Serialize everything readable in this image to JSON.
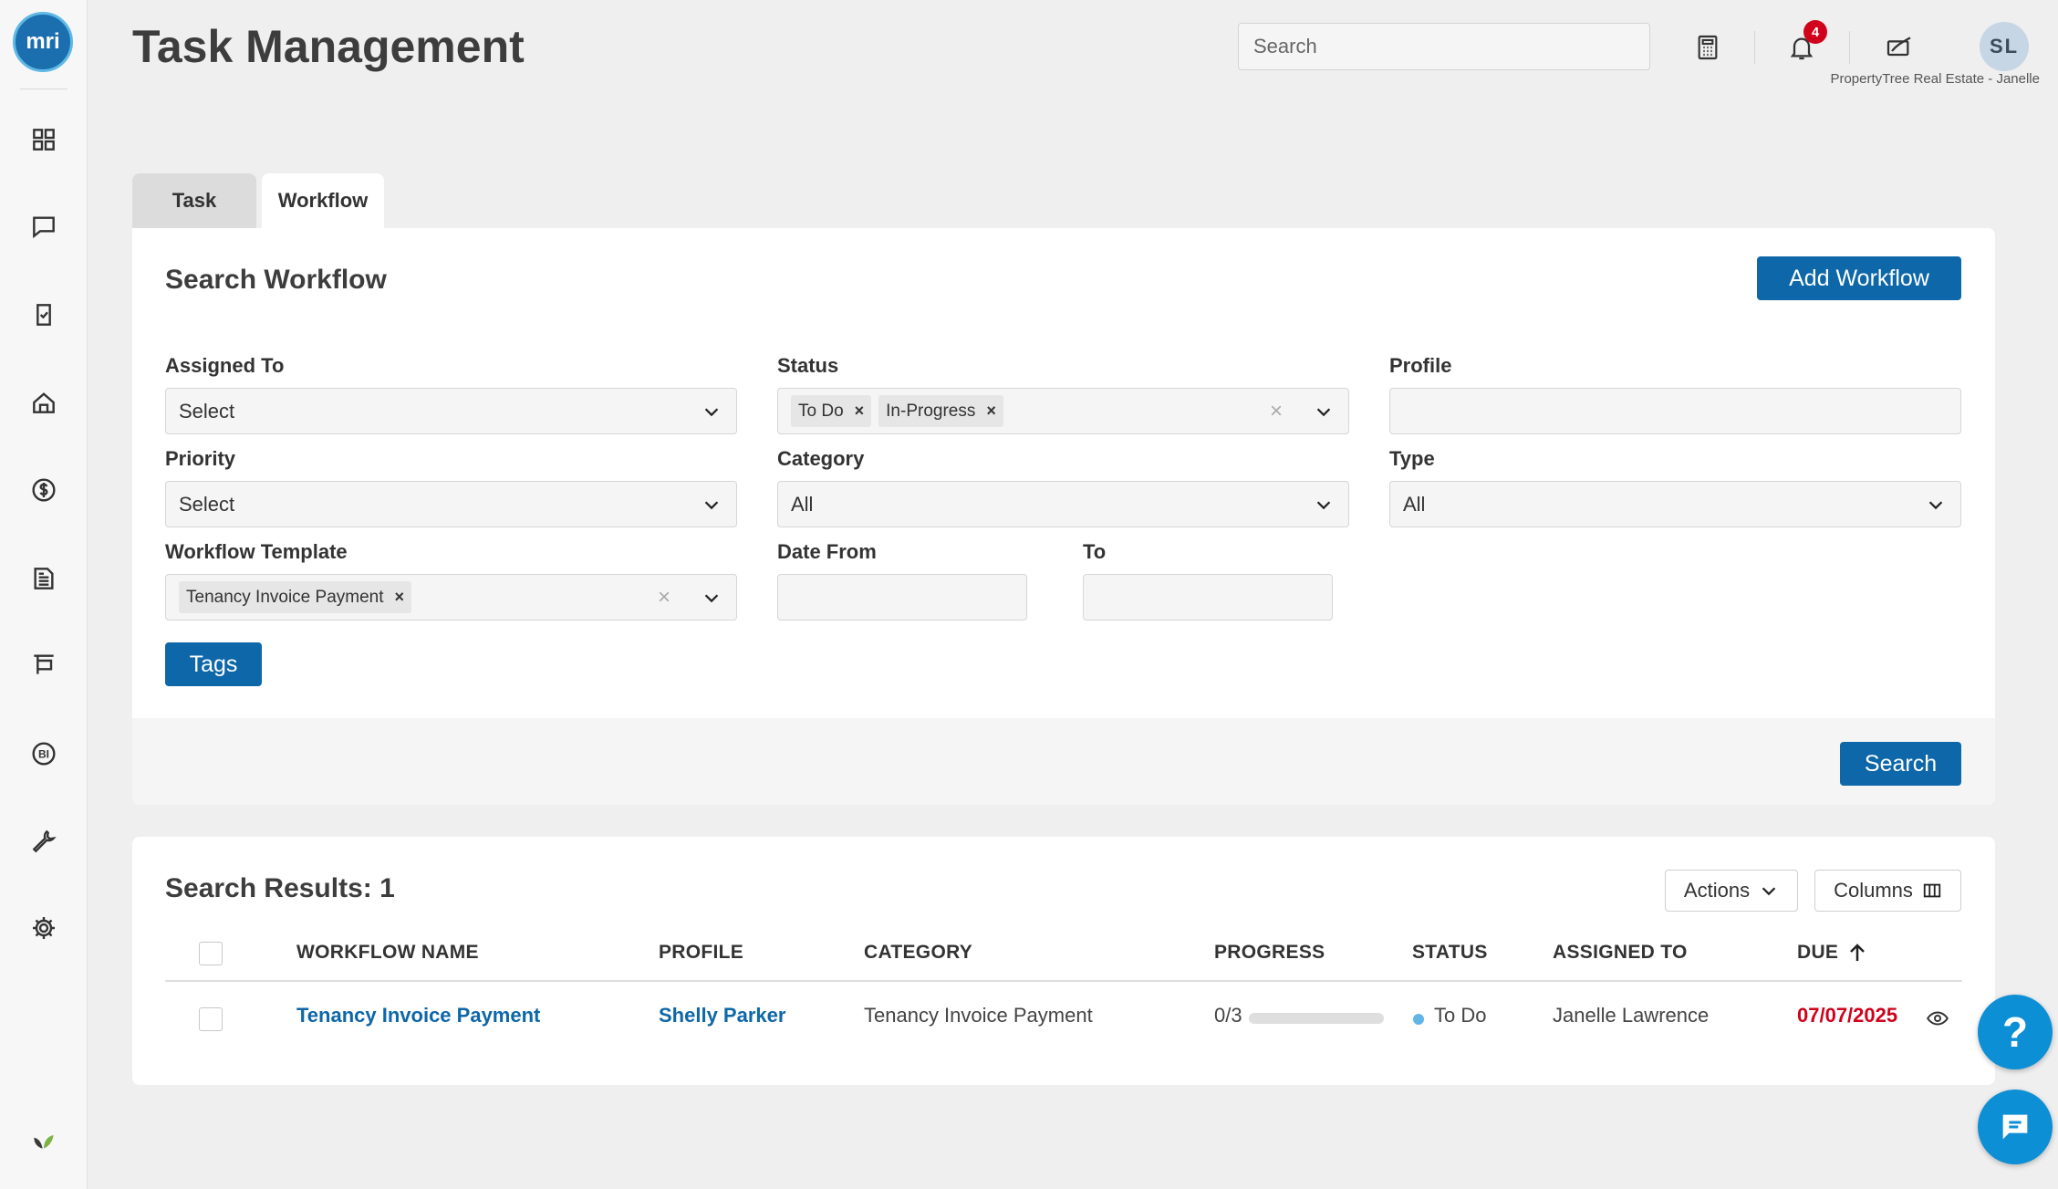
{
  "app": {
    "logo_text": "mri"
  },
  "header": {
    "title": "Task Management",
    "search_placeholder": "Search",
    "notification_count": "4",
    "avatar_initials": "SL",
    "org_user": "PropertyTree Real Estate - Janelle"
  },
  "sidebar": {
    "icons": [
      "dashboard-icon",
      "chat-icon",
      "task-checklist-icon",
      "property-icon",
      "finance-dollar-icon",
      "reports-document-icon",
      "sign-board-icon",
      "bi-icon",
      "wrench-icon",
      "settings-gear-icon"
    ],
    "bottom_icon": "leaf-icon"
  },
  "tabs": [
    {
      "label": "Task",
      "active": false
    },
    {
      "label": "Workflow",
      "active": true
    }
  ],
  "search_form": {
    "title": "Search Workflow",
    "add_button": "Add Workflow",
    "assigned_to": {
      "label": "Assigned To",
      "value": "Select"
    },
    "status": {
      "label": "Status",
      "chips": [
        "To Do",
        "In-Progress"
      ]
    },
    "profile": {
      "label": "Profile",
      "value": ""
    },
    "priority": {
      "label": "Priority",
      "value": "Select"
    },
    "category": {
      "label": "Category",
      "value": "All"
    },
    "type": {
      "label": "Type",
      "value": "All"
    },
    "workflow_template": {
      "label": "Workflow Template",
      "chips": [
        "Tenancy Invoice Payment"
      ]
    },
    "date_from": {
      "label": "Date From",
      "value": ""
    },
    "date_to": {
      "label": "To",
      "value": ""
    },
    "tags_button": "Tags",
    "search_button": "Search"
  },
  "results": {
    "title": "Search Results: 1",
    "actions_button": "Actions",
    "columns_button": "Columns",
    "columns": [
      "WORKFLOW NAME",
      "PROFILE",
      "CATEGORY",
      "PROGRESS",
      "STATUS",
      "ASSIGNED TO",
      "DUE"
    ],
    "sort_column": "DUE",
    "sort_direction": "ascending",
    "rows": [
      {
        "workflow_name": "Tenancy Invoice Payment",
        "profile": "Shelly Parker",
        "category": "Tenancy Invoice Payment",
        "progress": "0/3",
        "progress_fraction": 0,
        "status": "To Do",
        "assigned_to": "Janelle Lawrence",
        "due": "07/07/2025"
      }
    ]
  },
  "colors": {
    "primary": "#0d67a8",
    "due": "#d0021b",
    "status_todo": "#62b5e5",
    "badge": "#d0021b"
  }
}
